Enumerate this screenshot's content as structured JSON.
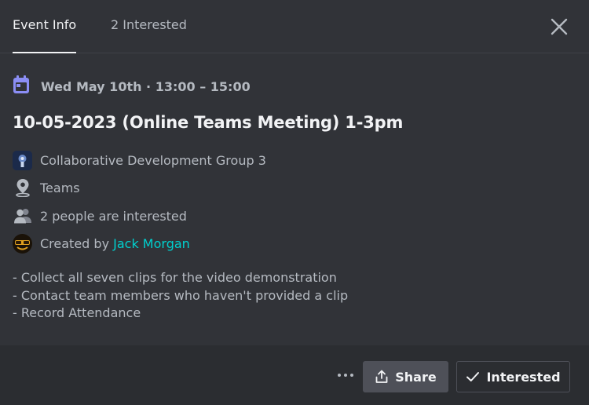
{
  "tabs": [
    {
      "label": "Event Info",
      "active": true
    },
    {
      "label": "2 Interested",
      "active": false
    }
  ],
  "event": {
    "datetime": "Wed May 10th · 13:00 – 15:00",
    "title": "10-05-2023 (Online Teams Meeting) 1-3pm",
    "server": "Collaborative Development Group 3",
    "location": "Teams",
    "interested": "2 people are interested",
    "created_by_prefix": "Created by ",
    "creator": "Jack Morgan",
    "description": [
      "- Collect all seven clips for the video demonstration",
      "- Contact team members who haven't provided a clip",
      "- Record Attendance"
    ]
  },
  "footer": {
    "share_label": "Share",
    "interested_label": "Interested"
  },
  "icons": {
    "close": "close-icon",
    "calendar": "calendar-icon",
    "server": "server-avatar",
    "location": "location-pin-icon",
    "people": "people-icon",
    "creator": "creator-avatar",
    "more": "more-options-icon",
    "share": "share-icon",
    "check": "checkmark-icon"
  },
  "colors": {
    "background": "#313338",
    "footer_background": "#2b2d31",
    "accent_calendar": "#8b8ef5",
    "link": "#00d0ce",
    "share_button": "#4e5058"
  }
}
